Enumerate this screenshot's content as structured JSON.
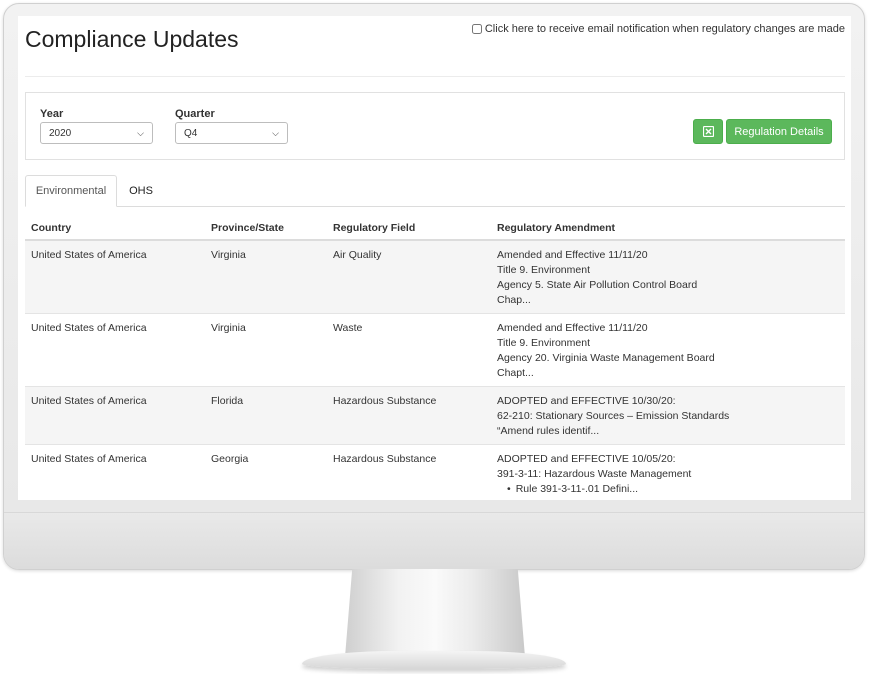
{
  "header": {
    "title": "Compliance Updates",
    "notify_label": "Click here to receive email notification when regulatory changes are made"
  },
  "filters": {
    "year_label": "Year",
    "year_value": "2020",
    "quarter_label": "Quarter",
    "quarter_value": "Q4",
    "details_button": "Regulation Details",
    "excel_icon": "excel-export-icon"
  },
  "tabs": [
    {
      "label": "Environmental",
      "active": true
    },
    {
      "label": "OHS",
      "active": false
    }
  ],
  "table": {
    "columns": [
      "Country",
      "Province/State",
      "Regulatory Field",
      "Regulatory Amendment"
    ],
    "rows": [
      {
        "country": "United States of America",
        "state": "Virginia",
        "field": "Air Quality",
        "amendment": [
          "Amended and Effective 11/11/20",
          "Title 9. Environment",
          "Agency 5. State Air Pollution Control Board",
          "Chap..."
        ]
      },
      {
        "country": "United States of America",
        "state": "Virginia",
        "field": "Waste",
        "amendment": [
          "Amended and Effective 11/11/20",
          "Title 9. Environment",
          "Agency 20. Virginia Waste Management Board",
          "Chapt..."
        ]
      },
      {
        "country": "United States of America",
        "state": "Florida",
        "field": "Hazardous Substance",
        "amendment": [
          "ADOPTED and EFFECTIVE 10/30/20:",
          "62-210: Stationary Sources – Emission Standards",
          "“Amend rules identif..."
        ]
      },
      {
        "country": "United States of America",
        "state": "Georgia",
        "field": "Hazardous Substance",
        "amendment": [
          "ADOPTED and EFFECTIVE 10/05/20:",
          "391-3-11: Hazardous Waste Management"
        ],
        "bullet": "Rule 391-3-11-.01 Defini..."
      }
    ]
  },
  "colors": {
    "button_green": "#5cb85c",
    "row_stripe": "#f5f5f5"
  }
}
